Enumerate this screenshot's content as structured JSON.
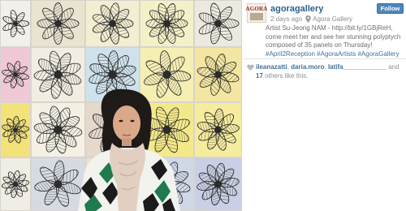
{
  "post": {
    "username": "agoragallery",
    "time_ago": "2 days ago",
    "separator": "·",
    "location": "Agora Gallery",
    "follow_label": "Follow",
    "avatar_text": "AGORA",
    "caption_plain": "Artist Su-Jeong NAM - http://bit.ly/1GBjReH, come meet her and see her stunning polyptych composed of 35 panels on Thursday!",
    "hashtags": [
      "#April2Reception",
      "#AgoraArtists",
      "#AgoraGallery"
    ]
  },
  "likes": {
    "users": [
      "ileanazatti",
      "daria.moro",
      "latifa____________"
    ],
    "and_text": "and",
    "count": "17",
    "suffix": "others like this."
  },
  "colors": {
    "accent": "#3f729b",
    "follow_button": "#4e86b8",
    "meta_text": "#8e8e8e"
  },
  "icons": [
    "location-pin-icon",
    "heart-icon"
  ]
}
